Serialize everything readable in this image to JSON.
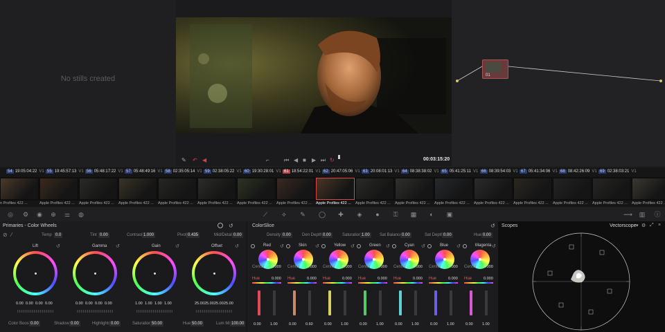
{
  "gallery": {
    "empty_message": "No stills created"
  },
  "viewer": {
    "timecode": "00:03:15:20"
  },
  "node": {
    "number": "01"
  },
  "timeline": {
    "clips": [
      {
        "num": "",
        "tc": "19:06:08:02",
        "track": "V1",
        "codec": "n Profiles 422 ...",
        "selected": false
      },
      {
        "num": "54",
        "tc": "19:05:04:22",
        "track": "V1",
        "codec": "Apple Profiles 422 ...",
        "selected": false
      },
      {
        "num": "55",
        "tc": "19:45:57:13",
        "track": "V1",
        "codec": "Apple Profiles 422 ...",
        "selected": false
      },
      {
        "num": "56",
        "tc": "05:48:17:22",
        "track": "V1",
        "codec": "Apple Profiles 422 ...",
        "selected": false
      },
      {
        "num": "57",
        "tc": "05:48:49:16",
        "track": "V1",
        "codec": "Apple Profiles 422 ...",
        "selected": false
      },
      {
        "num": "58",
        "tc": "02:35:05:14",
        "track": "V1",
        "codec": "Apple Profiles 422 ...",
        "selected": false
      },
      {
        "num": "59",
        "tc": "02:38:05:22",
        "track": "V1",
        "codec": "Apple Profiles 422 ...",
        "selected": false
      },
      {
        "num": "60",
        "tc": "19:30:28:01",
        "track": "V1",
        "codec": "Apple Profiles 422 ...",
        "selected": false
      },
      {
        "num": "61",
        "tc": "18:54:22:01",
        "track": "V1",
        "codec": "Apple Profiles 422 ...",
        "selected": true
      },
      {
        "num": "62",
        "tc": "20:47:05:06",
        "track": "V1",
        "codec": "Apple Profiles 422 ...",
        "selected": false
      },
      {
        "num": "63",
        "tc": "20:08:01:13",
        "track": "V1",
        "codec": "Apple Profiles 422 ...",
        "selected": false
      },
      {
        "num": "64",
        "tc": "08:38:38:02",
        "track": "V1",
        "codec": "Apple Profiles 422 ...",
        "selected": false
      },
      {
        "num": "65",
        "tc": "05:41:25:11",
        "track": "V1",
        "codec": "Apple Profiles 422 ...",
        "selected": false
      },
      {
        "num": "66",
        "tc": "08:39:54:03",
        "track": "V1",
        "codec": "Apple Profiles 422 ...",
        "selected": false
      },
      {
        "num": "67",
        "tc": "05:41:34:06",
        "track": "V1",
        "codec": "Apple Profiles 422 ...",
        "selected": false
      },
      {
        "num": "68",
        "tc": "08:42:26:09",
        "track": "V1",
        "codec": "Apple Profiles 422 ...",
        "selected": false
      },
      {
        "num": "69",
        "tc": "02:38:03:21",
        "track": "V1",
        "codec": "Apple Profiles 422 ...",
        "selected": false
      }
    ]
  },
  "primaries": {
    "title": "Primaries - Color Wheels",
    "temp_label": "Temp",
    "temp": "0.0",
    "tint_label": "Tint",
    "tint": "0.00",
    "contrast_label": "Contrast",
    "contrast": "1.000",
    "pivot_label": "Pivot",
    "pivot": "0.435",
    "mid_label": "Mid/Detail",
    "mid": "0.00",
    "wheels": [
      {
        "name": "Lift",
        "vals": [
          "0.00",
          "0.00",
          "0.00",
          "0.00"
        ]
      },
      {
        "name": "Gamma",
        "vals": [
          "0.00",
          "0.00",
          "0.00",
          "0.00"
        ]
      },
      {
        "name": "Gain",
        "vals": [
          "1.00",
          "1.00",
          "1.00",
          "1.00"
        ]
      },
      {
        "name": "Offset",
        "vals": [
          "25.00",
          "25.00",
          "25.00",
          "25.00"
        ]
      }
    ],
    "color_boost_label": "Color Boost",
    "color_boost": "0.00",
    "shadows_label": "Shadows",
    "shadows": "0.00",
    "highlights_label": "Highlights",
    "highlights": "0.00",
    "saturation_label": "Saturation",
    "saturation": "50.00",
    "hue_label": "Hue",
    "hue": "50.00",
    "lum_mix_label": "Lum Mix",
    "lum_mix": "100.00"
  },
  "colorslice": {
    "title": "ColorSlice",
    "density_label": "Density",
    "density": "0.00",
    "den_depth_label": "Den Depth",
    "den_depth": "0.00",
    "saturation_label": "Saturation",
    "saturation": "1.00",
    "sat_balance_label": "Sat Balance",
    "sat_balance": "0.00",
    "sat_depth_label": "Sat Depth",
    "sat_depth": "0.00",
    "hue_label": "Hue",
    "hue": "0.00",
    "center_label": "Center",
    "slice_hue_label": "Hue",
    "slices": [
      {
        "name": "Red",
        "center": "0.000",
        "hue": "0.000",
        "low": "0.00",
        "high": "1.00",
        "color": "#e04a5a"
      },
      {
        "name": "Skin",
        "center": "0.000",
        "hue": "0.000",
        "low": "0.00",
        "high": "0.60",
        "color": "#c98a6a"
      },
      {
        "name": "Yellow",
        "center": "0.000",
        "hue": "0.000",
        "low": "0.00",
        "high": "1.00",
        "color": "#d8d060"
      },
      {
        "name": "Green",
        "center": "0.000",
        "hue": "0.000",
        "low": "0.00",
        "high": "1.00",
        "color": "#56c868"
      },
      {
        "name": "Cyan",
        "center": "0.000",
        "hue": "0.000",
        "low": "0.00",
        "high": "1.00",
        "color": "#5ed0d6"
      },
      {
        "name": "Blue",
        "center": "0.000",
        "hue": "0.000",
        "low": "0.00",
        "high": "1.00",
        "color": "#6a60e0"
      },
      {
        "name": "Magenta",
        "center": "0.000",
        "hue": "0.000",
        "low": "0.00",
        "high": "1.00",
        "color": "#d85ad0"
      }
    ]
  },
  "scopes": {
    "title": "Scopes",
    "mode": "Vectorscope"
  }
}
